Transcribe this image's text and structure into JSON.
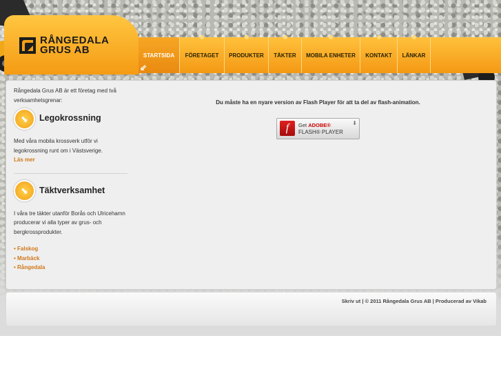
{
  "brand": {
    "line1": "RÅNGEDALA",
    "line2": "GRUS AB"
  },
  "nav": [
    {
      "label": "STARTSIDA",
      "active": true
    },
    {
      "label": "FÖRETAGET"
    },
    {
      "label": "PRODUKTER"
    },
    {
      "label": "TÄKTER"
    },
    {
      "label": "MOBILA ENHETER"
    },
    {
      "label": "KONTAKT"
    },
    {
      "label": "LÄNKAR"
    }
  ],
  "sidebar": {
    "intro": "Rångedala Grus AB är ett företag med två verksamhetsgrenar:",
    "section1": {
      "title": "Legokrossning",
      "text": "Med våra mobila krossverk utför vi legokrossning runt om i Västsverige.",
      "link": "Läs mer"
    },
    "section2": {
      "title": "Täktverksamhet",
      "text": "I våra tre täkter utanför Borås och Ulricehamn producerar vi alla typer av grus- och bergkrossprodukter.",
      "links": [
        "• Falskog",
        "• Marbäck",
        "• Rångedala"
      ]
    }
  },
  "content": {
    "notice": "Du måste ha en nyare version av Flash Player för att ta del av flash-animation.",
    "flash_button": {
      "line1_prefix": "Get",
      "line1_brand": "ADOBE®",
      "line2": "FLASH® PLAYER"
    }
  },
  "footer": {
    "print": "Skriv ut",
    "copyright": "| © 2011 Rångedala Grus AB | Producerad av",
    "producer": "Vikab"
  },
  "colors": {
    "accent": "#f49914",
    "link": "#d0781a",
    "panel": "#efefef"
  },
  "icons": [
    "logo-mark-icon",
    "arrow-down-right-icon",
    "flash-player-icon",
    "download-icon"
  ]
}
